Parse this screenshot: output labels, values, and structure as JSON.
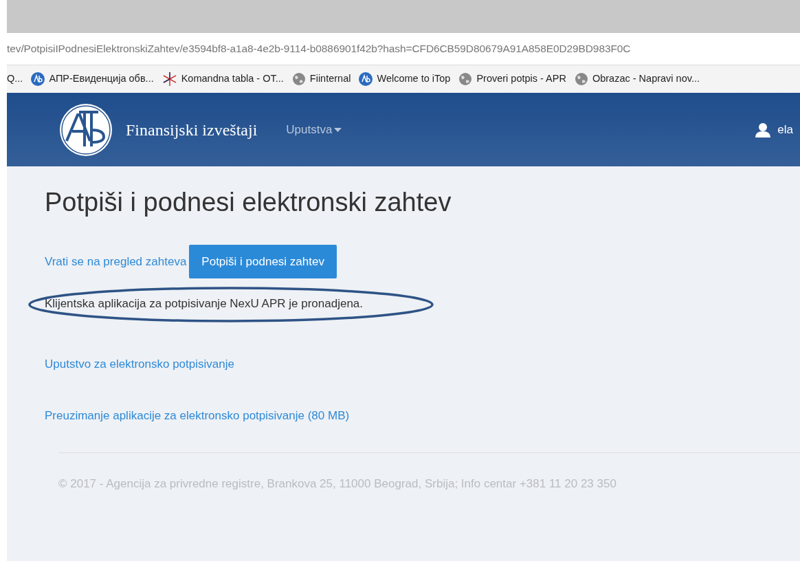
{
  "address_bar": {
    "url": "tev/PotpisiIPodnesiElektronskiZahtev/e3594bf8-a1a8-4e2b-9114-b0886901f42b?hash=CFD6CB59D80679A91A858E0D29BD983F0C"
  },
  "bookmarks": [
    {
      "label": "Q...",
      "kind": "plain"
    },
    {
      "label": "АПР-Евиденција обв...",
      "kind": "logo"
    },
    {
      "label": "Komandna tabla - OT...",
      "kind": "asterisk"
    },
    {
      "label": "Fiinternal",
      "kind": "globe"
    },
    {
      "label": "Welcome to iTop",
      "kind": "logo"
    },
    {
      "label": "Proveri potpis - APR",
      "kind": "globe"
    },
    {
      "label": "Obrazac - Napravi nov...",
      "kind": "globe"
    }
  ],
  "navbar": {
    "brand": "Finansijski izveštaji",
    "menu": "Uputstva",
    "user": "ela"
  },
  "page": {
    "title": "Potpiši i podnesi elektronski zahtev",
    "back_link": "Vrati se na pregled zahteva",
    "submit_button": "Potpiši i podnesi zahtev",
    "status": {
      "text": "Klijentska aplikacija za potpisivanje NexU APR je pronadjena.",
      "highlighted": true
    },
    "links": [
      "Uputstvo za elektronsko potpisivanje",
      "Preuzimanje aplikacije za elektronsko potpisivanje (80 MB)"
    ],
    "footer": "© 2017 - Agencija za privredne registre, Brankova 25, 11000 Beograd, Srbija; Info centar +381 11 20 23 350"
  }
}
